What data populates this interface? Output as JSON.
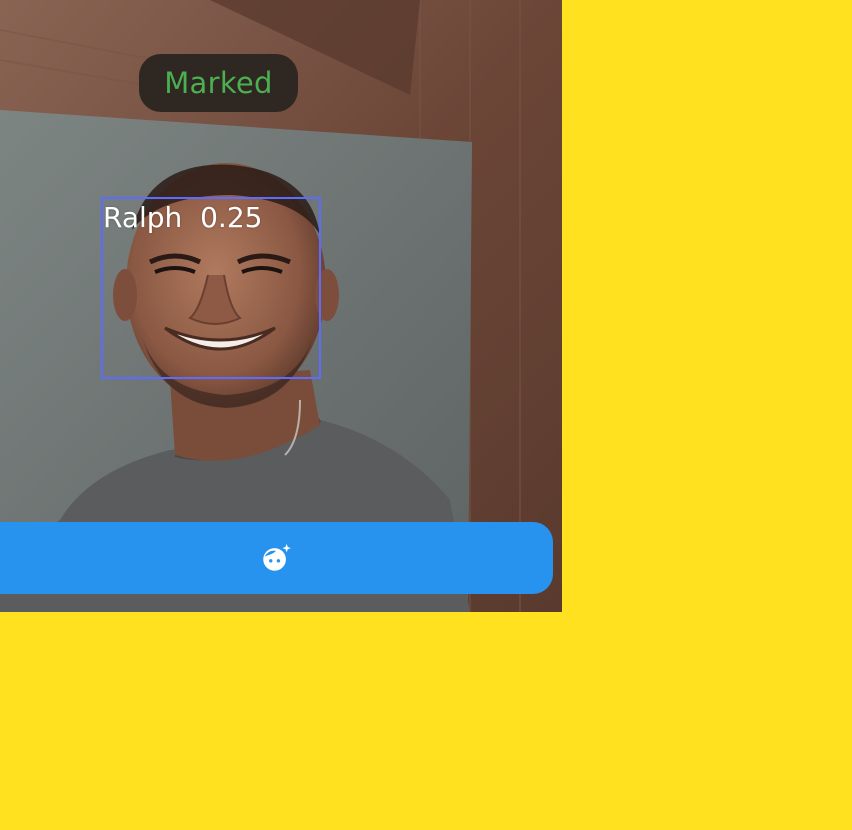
{
  "colors": {
    "page_background": "#FFE11F",
    "accent": "#2793EE",
    "status_green": "#4CAF50",
    "box_blue": "#5B6CFF"
  },
  "status_chip": {
    "label": "Marked"
  },
  "detection": {
    "name": "Ralph",
    "score": "0.25"
  },
  "action_bar": {
    "icon": "face-retouch-icon"
  }
}
